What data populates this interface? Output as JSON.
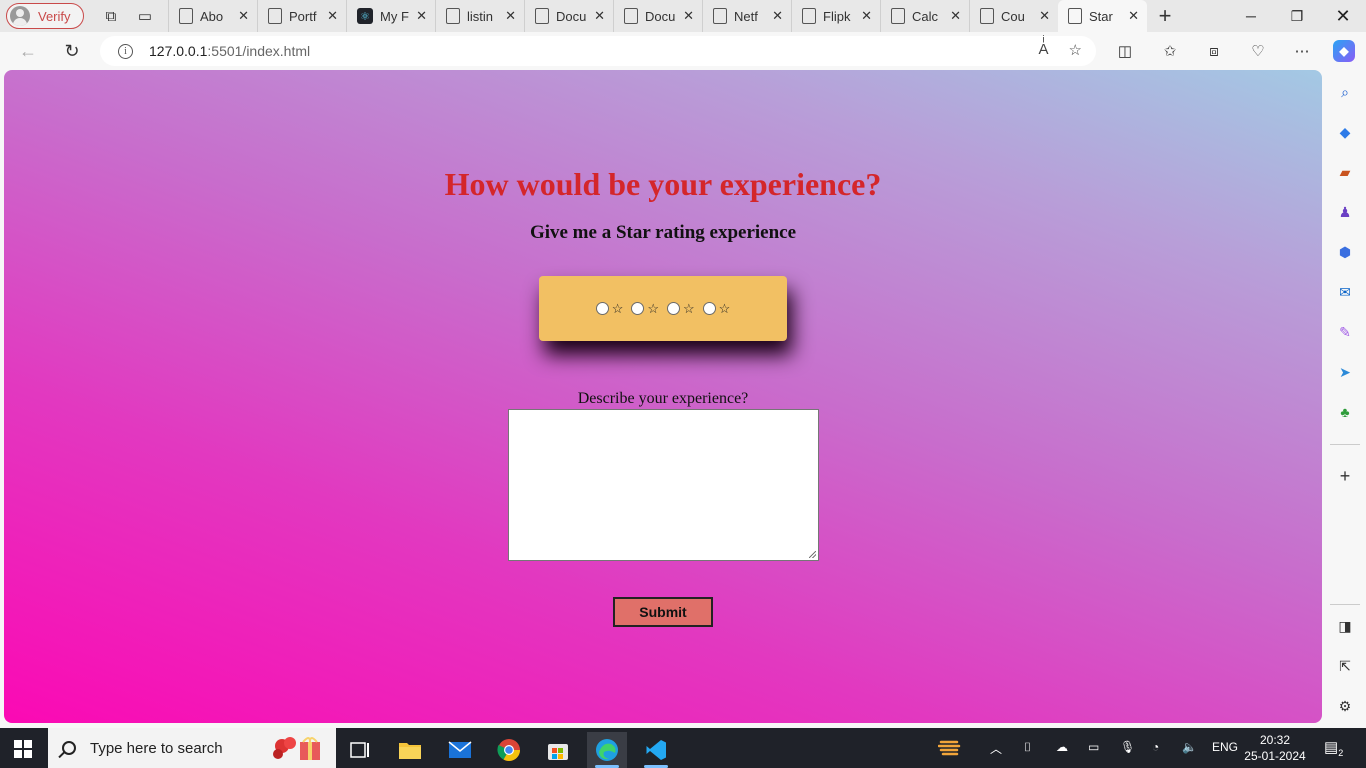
{
  "browser": {
    "profile_label": "Verify",
    "tabs": [
      {
        "label": "Abo",
        "icon": "page-icon"
      },
      {
        "label": "Portf",
        "icon": "page-icon"
      },
      {
        "label": "My F",
        "icon": "react-icon"
      },
      {
        "label": "listin",
        "icon": "page-icon"
      },
      {
        "label": "Docu",
        "icon": "page-icon"
      },
      {
        "label": "Docu",
        "icon": "page-icon"
      },
      {
        "label": "Netf",
        "icon": "page-icon"
      },
      {
        "label": "Flipk",
        "icon": "page-icon"
      },
      {
        "label": "Calc",
        "icon": "page-icon"
      },
      {
        "label": "Cou",
        "icon": "page-icon"
      },
      {
        "label": "Star",
        "icon": "page-icon",
        "active": true
      }
    ],
    "url_host": "127.0.0.1",
    "url_path": ":5501/index.html"
  },
  "page": {
    "title": "How would be your experience?",
    "subtitle": "Give me a Star rating experience",
    "star_glyph": "☆",
    "rating_count": 4,
    "description_label": "Describe your experience?",
    "description_value": "",
    "submit_label": "Submit",
    "colors": {
      "title": "#d4262a",
      "rating_box": "#f2c063",
      "submit_bg": "#e07069",
      "gradient_start": "#fb09b4",
      "gradient_end": "#a3c9e4"
    }
  },
  "taskbar": {
    "search_placeholder": "Type here to search",
    "language": "ENG",
    "time": "20:32",
    "date": "25-01-2024",
    "notification_count": "2"
  }
}
